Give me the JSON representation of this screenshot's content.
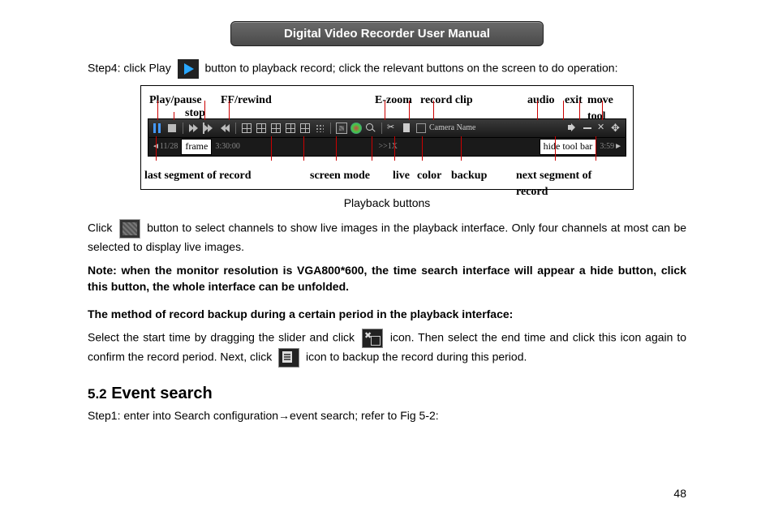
{
  "header": {
    "title": "Digital Video Recorder User Manual"
  },
  "step4": {
    "prefix": "Step4: click Play",
    "suffix": "button to playback record; click the relevant buttons on the screen to do operation:"
  },
  "figure": {
    "labels_top": {
      "play_pause": "Play/pause",
      "stop": "stop",
      "ff_rewind": "FF/rewind",
      "e_zoom": "E-zoom",
      "record_clip": "record clip",
      "audio": "audio",
      "exit": "exit",
      "move_tool": "move tool"
    },
    "toolbar": {
      "camera_name": "Camera Name"
    },
    "timeline": {
      "date_left": "11/28",
      "frame_label": "frame",
      "time_left": "3:30:00",
      "speed": ">>1X",
      "hide_tool_bar": "hide tool bar",
      "time_right": "3:59"
    },
    "labels_bot": {
      "last_segment": "last segment of record",
      "screen_mode": "screen mode",
      "live": "live",
      "color": "color",
      "backup": "backup",
      "next_segment": "next segment of record"
    },
    "caption": "Playback buttons"
  },
  "click_para": {
    "a": "Click",
    "b": "button to select channels to show live images in the playback interface. Only four channels at most can be selected to display live images."
  },
  "note_text": "Note: when the monitor resolution is VGA800*600, the time search interface will appear a hide button, click this button, the whole interface can be unfolded.",
  "backup_heading": "The method of record backup during a certain period in the playback interface:",
  "backup_para": {
    "a": "Select the start time by dragging the slider and click",
    "b": "icon. Then select the end time and click this icon again to confirm the record period. Next, click",
    "c": "icon to backup the record during this period."
  },
  "section": {
    "number": "5.2",
    "title": "Event search",
    "step1": "Step1: enter into Search configuration→event search; refer to Fig 5-2:"
  },
  "page_number": "48"
}
